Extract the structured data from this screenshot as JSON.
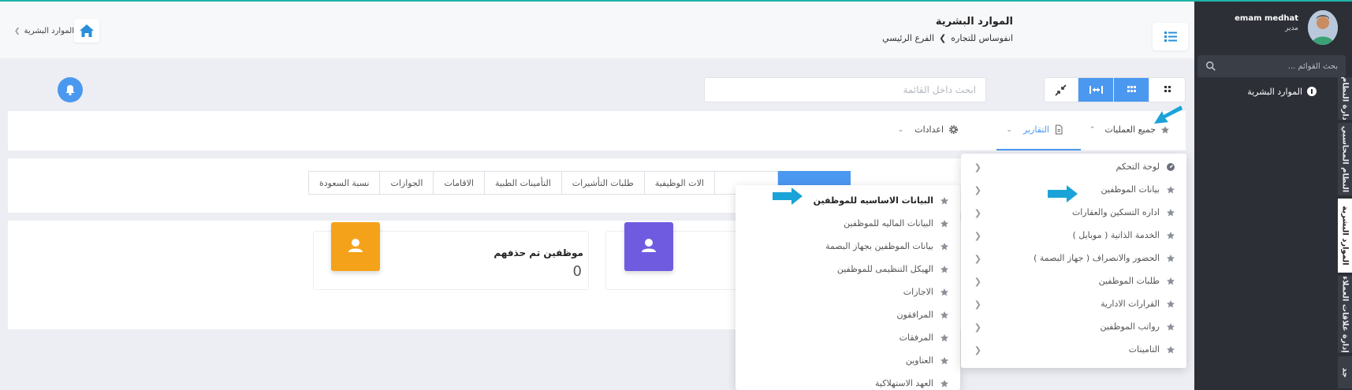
{
  "sidebar": {
    "user_name": "emam medhat",
    "user_role": "مدير",
    "search_placeholder": "بحث القوائم ...",
    "menu_item": "الموارد البشرية",
    "vertical_tabs": [
      "دارة النظام",
      "النظام المحاسبي",
      "الموارد البشرية",
      "إدارة علاقات العملاء",
      "جد"
    ]
  },
  "header": {
    "title": "الموارد البشرية",
    "breadcrumb": [
      "انفوساس للتجاره",
      "الفرع الرئيسي"
    ],
    "left_breadcrumb": "الموارد البشرية"
  },
  "toolbar": {
    "search_placeholder": "ابحث داخل القائمة"
  },
  "nav": {
    "all_operations": "جميع العمليات",
    "reports": "التقارير",
    "settings": "اعدادات"
  },
  "tabs": [
    "الات الوظيفية",
    "طلبات التأشيرات",
    "التأمينات الطبية",
    "الاقامات",
    "الجوازات",
    "نسبة السعودة"
  ],
  "cards": [
    {
      "title": "موظفين تم حذفهم",
      "value": "0"
    }
  ],
  "dropdown_main": [
    "لوحة التحكم",
    "بيانات الموظفين",
    "اداره التسكين والعقارات",
    "الخدمة الذاتية ( موبايل )",
    "الحضور والانصراف ( جهاز البصمة )",
    "طلبات الموظفين",
    "القرارات الادارية",
    "رواتب الموظفين",
    "التامينات"
  ],
  "dropdown_sub": [
    "البيانات الاساسيه للموظفين",
    "البيانات الماليه للموظفين",
    "بيانات الموظفين بجهاز البصمة",
    "الهيكل التنظيمى للموظفين",
    "الاجازات",
    "المرافقون",
    "المرفقات",
    "العناوين",
    "العهد الاستهلاكية"
  ],
  "colors": {
    "accent": "#4b98f0",
    "sidebar_bg": "#2c2f36",
    "card_orange": "#f5a21b",
    "card_purple": "#6f5be0",
    "arrow": "#1aa3d8"
  },
  "icons": {
    "menu": "list-icon",
    "home": "home-icon",
    "bell": "bell-icon",
    "star": "star-icon",
    "user": "user-icon"
  }
}
